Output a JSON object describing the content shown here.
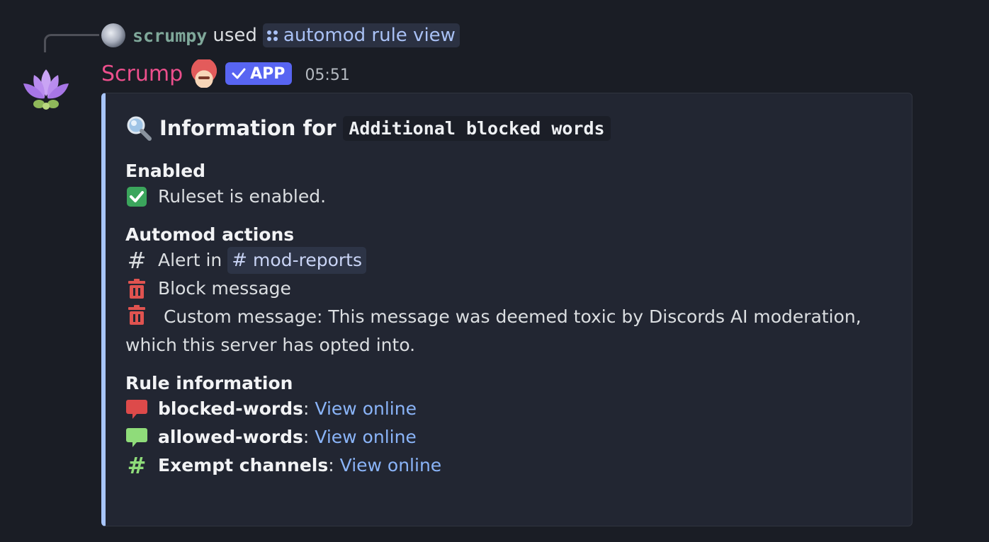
{
  "reply": {
    "username": "scrumpy",
    "used_text": "used",
    "command": "automod rule view"
  },
  "message": {
    "author": "Scrump",
    "badge": "APP",
    "timestamp": "05:51"
  },
  "embed": {
    "accent_color": "#a8c5fb",
    "title_prefix": "Information for",
    "title_code": "Additional blocked words",
    "enabled": {
      "name": "Enabled",
      "text": "Ruleset is enabled."
    },
    "actions": {
      "name": "Automod actions",
      "alert_text": "Alert in",
      "alert_channel": "mod-reports",
      "block_text": "Block message",
      "custom_text": "Custom message: This message was deemed toxic by Discords AI moderation, which this server has opted into."
    },
    "rule_info": {
      "name": "Rule information",
      "separator": ":",
      "items": [
        {
          "label": "blocked-words",
          "link": "View online",
          "icon": "red-speech-bubble-icon"
        },
        {
          "label": "allowed-words",
          "link": "View online",
          "icon": "green-speech-bubble-icon"
        },
        {
          "label": "Exempt channels",
          "link": "View online",
          "icon": "green-hash-icon"
        }
      ]
    }
  },
  "colors": {
    "author": "#ec4f8c",
    "reply_user": "#7fa89a",
    "badge": "#5865f2",
    "link": "#8ab4f8"
  }
}
